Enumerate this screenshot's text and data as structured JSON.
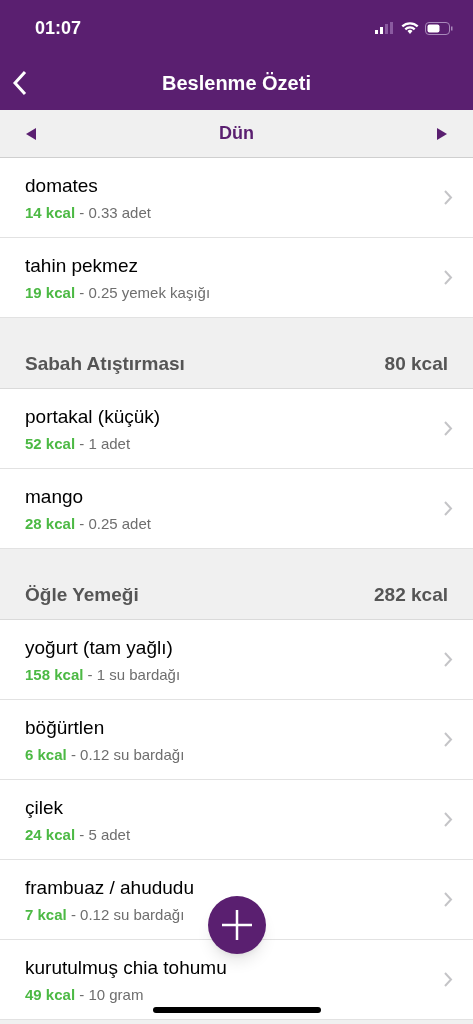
{
  "status_bar": {
    "time": "01:07"
  },
  "nav": {
    "title": "Beslenme Özeti"
  },
  "date_nav": {
    "label": "Dün"
  },
  "sections": [
    {
      "items": [
        {
          "name": "domates",
          "kcal": "14 kcal",
          "amount": " - 0.33 adet"
        },
        {
          "name": "tahin pekmez",
          "kcal": "19 kcal",
          "amount": " - 0.25 yemek kaşığı"
        }
      ]
    },
    {
      "title": "Sabah Atıştırması",
      "total": "80 kcal",
      "items": [
        {
          "name": "portakal (küçük)",
          "kcal": "52 kcal",
          "amount": " - 1 adet"
        },
        {
          "name": "mango",
          "kcal": "28 kcal",
          "amount": " - 0.25 adet"
        }
      ]
    },
    {
      "title": "Öğle Yemeği",
      "total": "282 kcal",
      "items": [
        {
          "name": "yoğurt (tam yağlı)",
          "kcal": "158 kcal",
          "amount": " - 1 su bardağı"
        },
        {
          "name": "böğürtlen",
          "kcal": "6 kcal",
          "amount": " - 0.12 su bardağı"
        },
        {
          "name": "çilek",
          "kcal": "24 kcal",
          "amount": " - 5 adet"
        },
        {
          "name": "frambuaz / ahududu",
          "kcal": "7 kcal",
          "amount": " - 0.12 su bardağı"
        },
        {
          "name": "kurutulmuş chia tohumu",
          "kcal": "49 kcal",
          "amount": " - 10 gram"
        }
      ]
    }
  ]
}
